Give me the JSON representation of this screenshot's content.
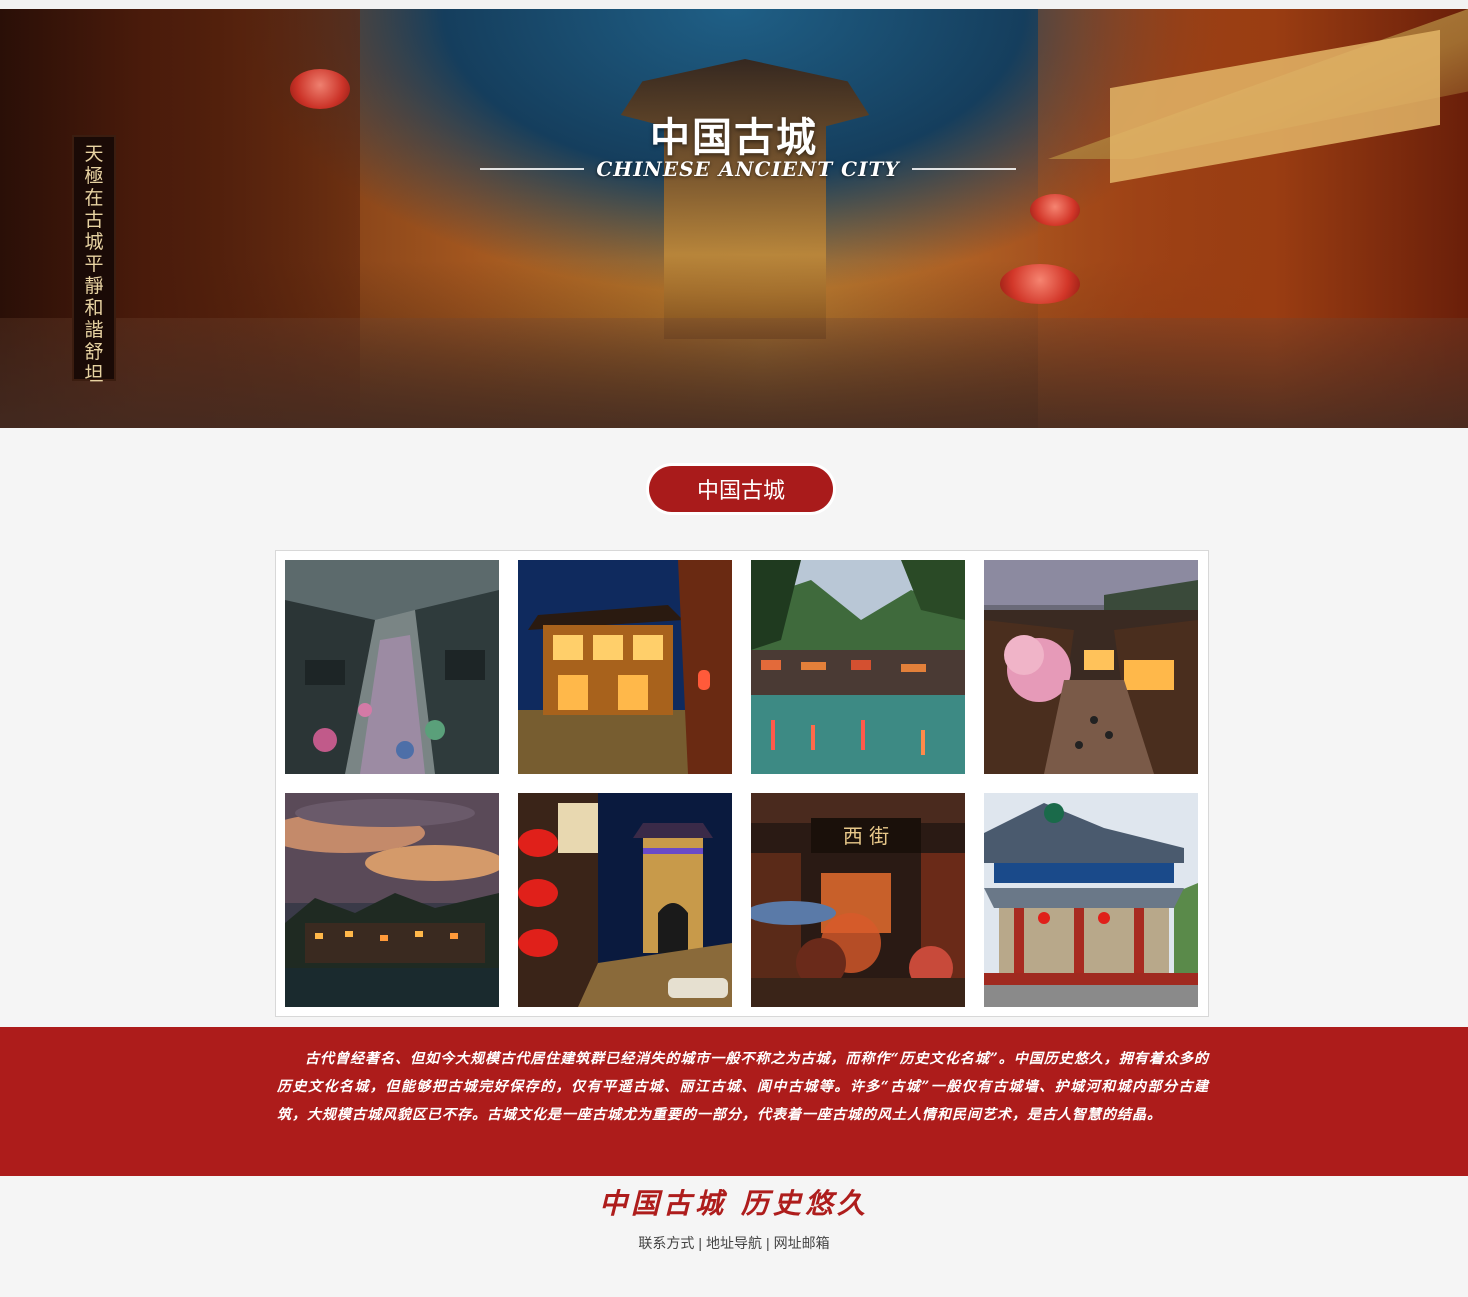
{
  "hero": {
    "title": "中国古城",
    "subtitle": "CHINESE ANCIENT CITY",
    "vertical_sign": [
      "天",
      "極",
      "在",
      "古",
      "城",
      "平",
      "靜",
      "和",
      "諧",
      "舒",
      "坦"
    ]
  },
  "section": {
    "title": "中国古城"
  },
  "gallery": {
    "photos": [
      {
        "name": "rainy-street-photo"
      },
      {
        "name": "night-house-photo"
      },
      {
        "name": "riverside-town-photo"
      },
      {
        "name": "blossom-street-photo"
      },
      {
        "name": "sunset-village-photo"
      },
      {
        "name": "lantern-gate-photo"
      },
      {
        "name": "west-street-photo"
      },
      {
        "name": "pavilion-photo"
      }
    ]
  },
  "intro": {
    "text": "古代曾经著名、但如今大规模古代居住建筑群已经消失的城市一般不称之为古城，而称作“历史文化名城”。中国历史悠久，拥有着众多的历史文化名城，但能够把古城完好保存的，仅有平遥古城、丽江古城、阆中古城等。许多“古城”一般仅有古城墙、护城河和城内部分古建筑，大规模古城风貌区已不存。古城文化是一座古城尤为重要的一部分，代表着一座古城的风土人情和民间艺术，是古人智慧的结晶。"
  },
  "footer": {
    "title": "中国古城 历史悠久",
    "links": [
      "联系方式",
      "地址导航",
      "网址邮箱"
    ],
    "separator": "|"
  },
  "colors": {
    "accent_red": "#ad1c1b",
    "page_bg": "#f5f5f5"
  }
}
